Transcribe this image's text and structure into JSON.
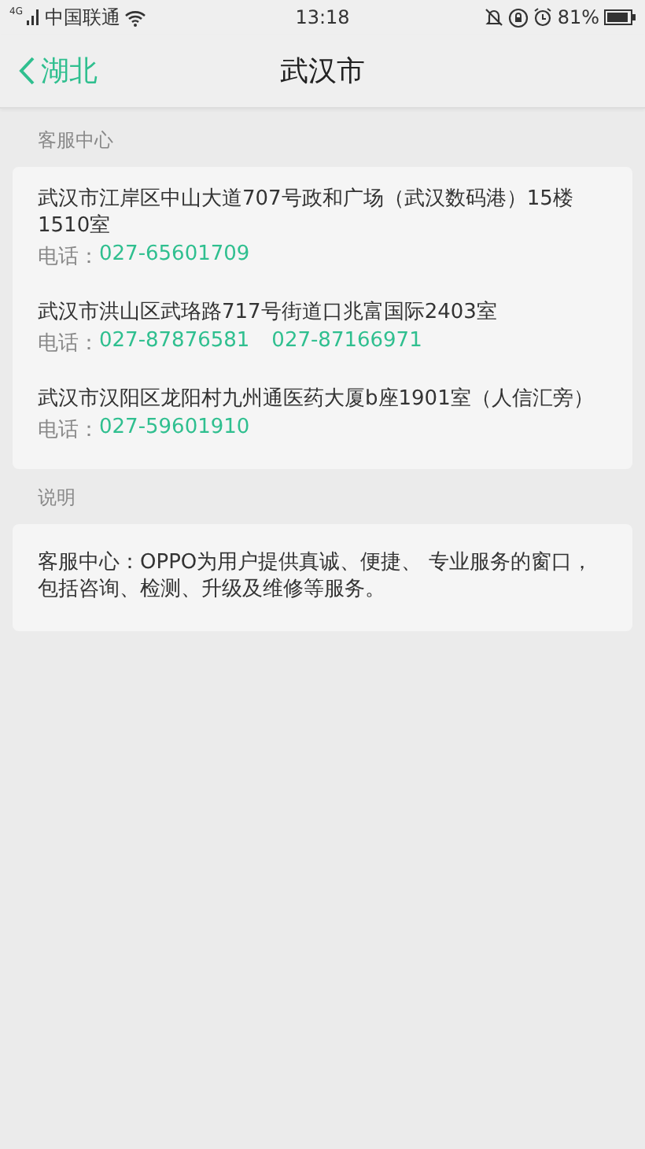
{
  "status_bar": {
    "network": "4G",
    "carrier": "中国联通",
    "time": "13:18",
    "battery": "81%"
  },
  "nav": {
    "back": "湖北",
    "title": "武汉市"
  },
  "sections": [
    {
      "title": "客服中心",
      "kind": "contacts",
      "items": [
        {
          "address": "武汉市江岸区中山大道707号政和广场（武汉数码港）15楼1510室",
          "phone_label": "电话：",
          "phones": [
            "027-65601709"
          ]
        },
        {
          "address": "武汉市洪山区武珞路717号街道口兆富国际2403室",
          "phone_label": "电话：",
          "phones": [
            "027-87876581",
            "027-87166971"
          ]
        },
        {
          "address": "武汉市汉阳区龙阳村九州通医药大厦b座1901室（人信汇旁）",
          "phone_label": "电话：",
          "phones": [
            "027-59601910"
          ]
        }
      ]
    },
    {
      "title": "说明",
      "kind": "note",
      "text": "客服中心：OPPO为用户提供真诚、便捷、 专业服务的窗口，包括咨询、检测、升级及维修等服务。"
    }
  ]
}
